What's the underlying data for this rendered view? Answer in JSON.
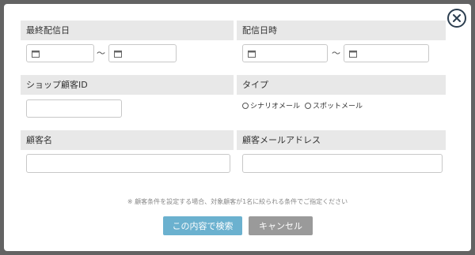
{
  "icons": {
    "close": "close-icon",
    "calendar": "calendar-icon"
  },
  "colors": {
    "search_button": "#6bb1cf",
    "cancel_button": "#9a9a9a",
    "overlay": "#636363",
    "label_bar": "#e8e8e8"
  },
  "form": {
    "last_delivery_date": {
      "label": "最終配信日",
      "from_value": "",
      "to_value": "",
      "separator": "〜"
    },
    "delivery_datetime": {
      "label": "配信日時",
      "from_value": "",
      "to_value": "",
      "separator": "〜"
    },
    "shop_customer_id": {
      "label": "ショップ顧客ID",
      "value": ""
    },
    "type": {
      "label": "タイプ",
      "options": [
        {
          "label": "シナリオメール",
          "selected": false
        },
        {
          "label": "スポットメール",
          "selected": false
        }
      ]
    },
    "customer_name": {
      "label": "顧客名",
      "value": ""
    },
    "customer_email": {
      "label": "顧客メールアドレス",
      "value": ""
    }
  },
  "note": "※ 顧客条件を設定する場合、対象顧客が1名に絞られる条件でご指定ください",
  "buttons": {
    "search": "この内容で検索",
    "cancel": "キャンセル"
  }
}
